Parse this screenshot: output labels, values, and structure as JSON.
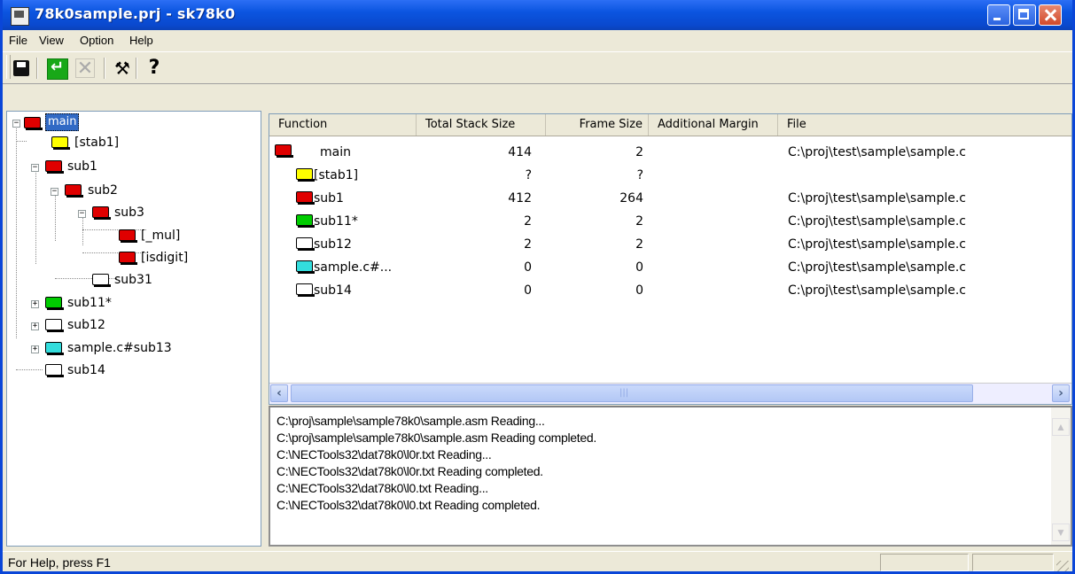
{
  "window": {
    "title": "78k0sample.prj - sk78k0"
  },
  "menu": [
    "File",
    "View",
    "Option",
    "Help"
  ],
  "toolbar": {
    "icons": [
      "save-icon",
      "refresh-icon",
      "cancel-icon",
      "build-icon",
      "help-icon"
    ]
  },
  "tree": {
    "nodes": [
      {
        "label": "main",
        "color": "#e00000",
        "selected": true,
        "expander": "minus"
      },
      {
        "label": "[stab1]",
        "color": "#ffff00"
      },
      {
        "label": "sub1",
        "color": "#e00000",
        "expander": "minus"
      },
      {
        "label": "sub2",
        "color": "#e00000",
        "expander": "minus"
      },
      {
        "label": "sub3",
        "color": "#e00000",
        "expander": "minus"
      },
      {
        "label": "[_mul]",
        "color": "#e00000"
      },
      {
        "label": "[isdigit]",
        "color": "#e00000"
      },
      {
        "label": "sub31",
        "color": "#ffffff"
      },
      {
        "label": "sub11*",
        "color": "#00cc00",
        "expander": "plus"
      },
      {
        "label": "sub12",
        "color": "#ffffff",
        "expander": "plus"
      },
      {
        "label": "sample.c#sub13",
        "color": "#33dddd",
        "expander": "plus"
      },
      {
        "label": "sub14",
        "color": "#ffffff"
      }
    ]
  },
  "grid": {
    "columns": [
      "Function",
      "Total Stack Size",
      "Frame Size",
      "Additional Margin",
      "File"
    ],
    "rows": [
      {
        "func": "main",
        "total": "414",
        "frame": "2",
        "margin": "",
        "file": "C:\\proj\\test\\sample\\sample.c",
        "color": "#e00000"
      },
      {
        "func": "[stab1]",
        "total": "?",
        "frame": "?",
        "margin": "",
        "file": "",
        "color": "#ffff00"
      },
      {
        "func": "sub1",
        "total": "412",
        "frame": "264",
        "margin": "",
        "file": "C:\\proj\\test\\sample\\sample.c",
        "color": "#e00000"
      },
      {
        "func": "sub11*",
        "total": "2",
        "frame": "2",
        "margin": "",
        "file": "C:\\proj\\test\\sample\\sample.c",
        "color": "#00cc00"
      },
      {
        "func": "sub12",
        "total": "2",
        "frame": "2",
        "margin": "",
        "file": "C:\\proj\\test\\sample\\sample.c",
        "color": "#ffffff"
      },
      {
        "func": "sample.c#...",
        "total": "0",
        "frame": "0",
        "margin": "",
        "file": "C:\\proj\\test\\sample\\sample.c",
        "color": "#33dddd"
      },
      {
        "func": "sub14",
        "total": "0",
        "frame": "0",
        "margin": "",
        "file": "C:\\proj\\test\\sample\\sample.c",
        "color": "#ffffff"
      }
    ]
  },
  "log": {
    "lines": [
      "C:\\proj\\sample\\sample78k0\\sample.asm Reading...",
      "C:\\proj\\sample\\sample78k0\\sample.asm Reading completed.",
      "C:\\NECTools32\\dat78k0\\l0r.txt Reading...",
      "C:\\NECTools32\\dat78k0\\l0r.txt Reading completed.",
      "C:\\NECTools32\\dat78k0\\l0.txt Reading...",
      "C:\\NECTools32\\dat78k0\\l0.txt Reading completed."
    ]
  },
  "status": {
    "text": "For Help, press F1"
  }
}
